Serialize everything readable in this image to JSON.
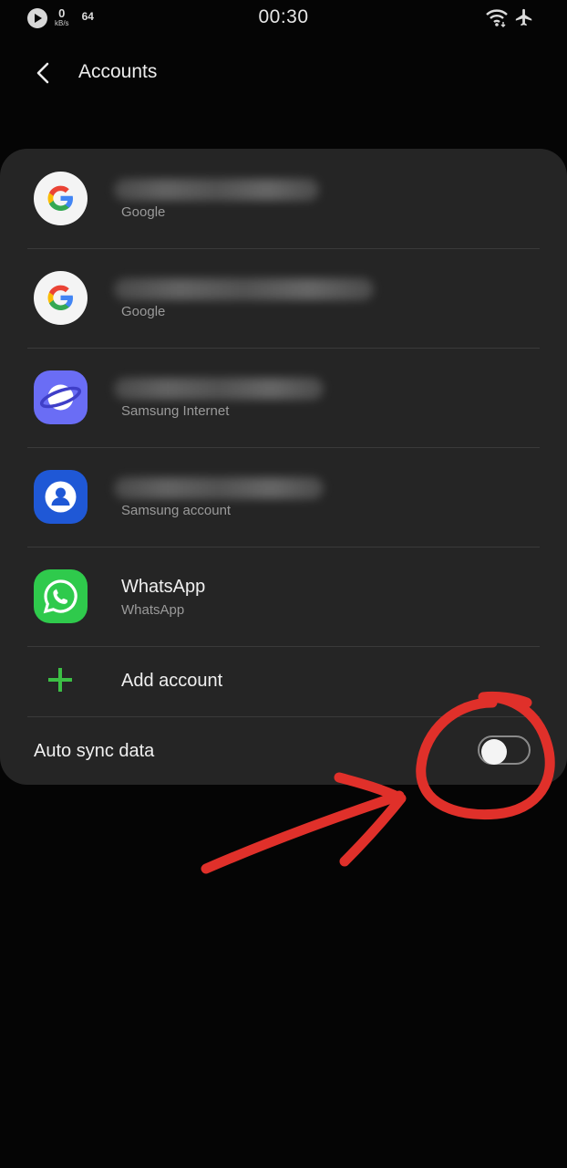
{
  "status_bar": {
    "speed_value": "0",
    "speed_unit": "kB/s",
    "notification_count": "64",
    "time": "00:30"
  },
  "app_bar": {
    "title": "Accounts"
  },
  "accounts": [
    {
      "name": "",
      "type": "Google",
      "icon": "google-icon"
    },
    {
      "name": "",
      "type": "Google",
      "icon": "google-icon"
    },
    {
      "name": "",
      "type": "Samsung Internet",
      "icon": "samsung-internet-icon"
    },
    {
      "name": "",
      "type": "Samsung account",
      "icon": "samsung-account-icon"
    },
    {
      "name": "WhatsApp",
      "type": "WhatsApp",
      "icon": "whatsapp-icon"
    }
  ],
  "add_account_label": "Add account",
  "auto_sync": {
    "label": "Auto sync data",
    "enabled": false
  },
  "colors": {
    "background": "#050505",
    "card": "#252525",
    "accent_green": "#3cbf45",
    "annotation_red": "#e0302a"
  }
}
